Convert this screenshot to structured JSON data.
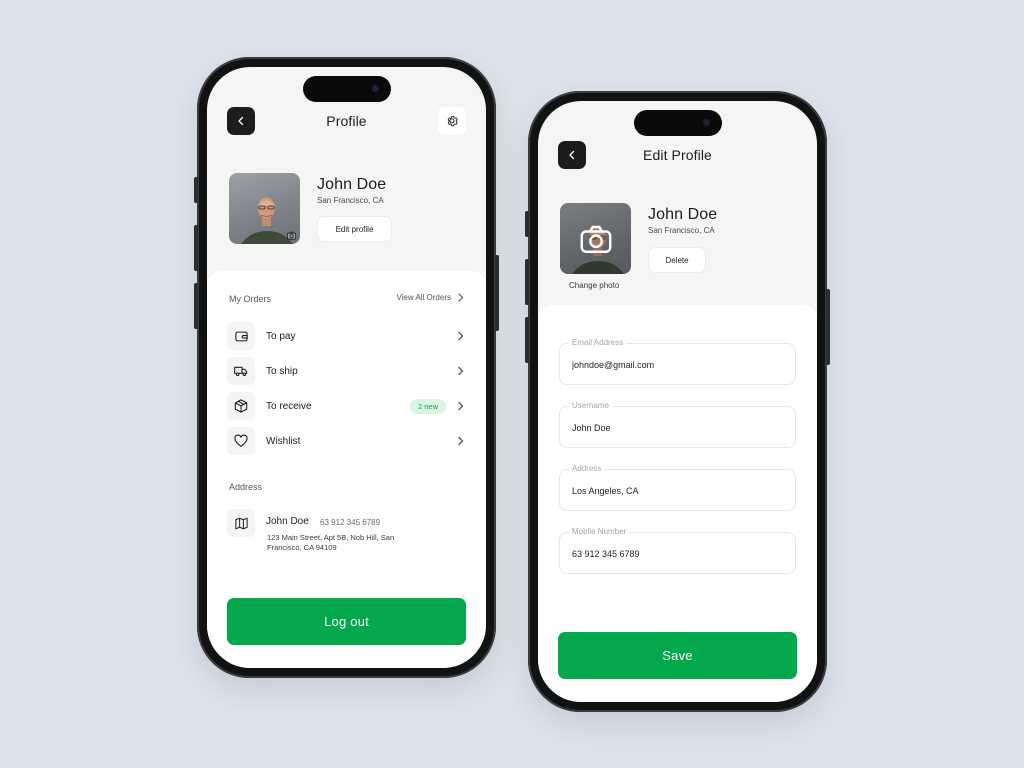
{
  "left_screen": {
    "title": "Profile",
    "profile": {
      "name": "John Doe",
      "location": "San Francisco, CA",
      "edit_label": "Edit profile"
    },
    "orders": {
      "label": "My Orders",
      "view_all": "View All Orders",
      "items": [
        {
          "label": "To pay",
          "icon": "wallet-icon"
        },
        {
          "label": "To ship",
          "icon": "truck-icon"
        },
        {
          "label": "To receive",
          "icon": "box-icon",
          "badge": "2 new"
        },
        {
          "label": "Wishlist",
          "icon": "heart-icon"
        }
      ]
    },
    "address": {
      "label": "Address",
      "name": "John Doe",
      "phone": "63 912 345 6789",
      "line": "123 Main Street, Apt 5B, Nob Hill, San Francisco, CA 94109"
    },
    "logout_label": "Log out"
  },
  "right_screen": {
    "title": "Edit Profile",
    "profile": {
      "name": "John Doe",
      "location": "San Francisco, CA",
      "delete_label": "Delete",
      "change_photo": "Change photo"
    },
    "fields": [
      {
        "label": "Email Address",
        "value": "johndoe@gmail.com"
      },
      {
        "label": "Username",
        "value": "John Doe"
      },
      {
        "label": "Address",
        "value": "Los Angeles, CA"
      },
      {
        "label": "Mobile Number",
        "value": "63 912 345 6789"
      }
    ],
    "save_label": "Save"
  },
  "colors": {
    "background": "#dde3ea",
    "accent_green": "#03a84c",
    "badge_bg": "#d9f5e3",
    "badge_text": "#17a34a",
    "dark_button": "#1c1c1e"
  }
}
